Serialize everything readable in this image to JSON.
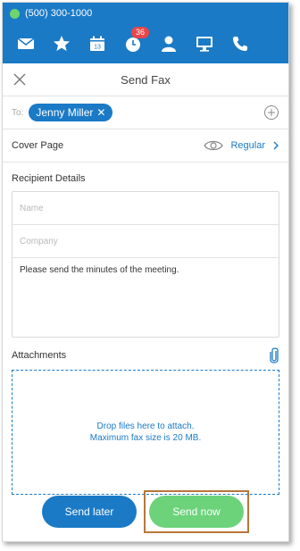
{
  "status": {
    "phone": "(500) 300-1000"
  },
  "toolbar": {
    "badge": "36",
    "calendar_day": "13"
  },
  "header": {
    "title": "Send Fax"
  },
  "to": {
    "label": "To:",
    "recipient": "Jenny Miller"
  },
  "cover": {
    "label": "Cover Page",
    "value": "Regular"
  },
  "recipient": {
    "section_label": "Recipient Details",
    "name_placeholder": "Name",
    "company_placeholder": "Company",
    "message": "Please send the minutes of the meeting."
  },
  "attachments": {
    "label": "Attachments",
    "drop_text": "Drop files here to attach.",
    "size_text": "Maximum fax size is 20 MB."
  },
  "actions": {
    "send_later": "Send later",
    "send_now": "Send now"
  },
  "colors": {
    "primary": "#1a7ac6",
    "success": "#6cd37a",
    "highlight": "#b8763a"
  }
}
